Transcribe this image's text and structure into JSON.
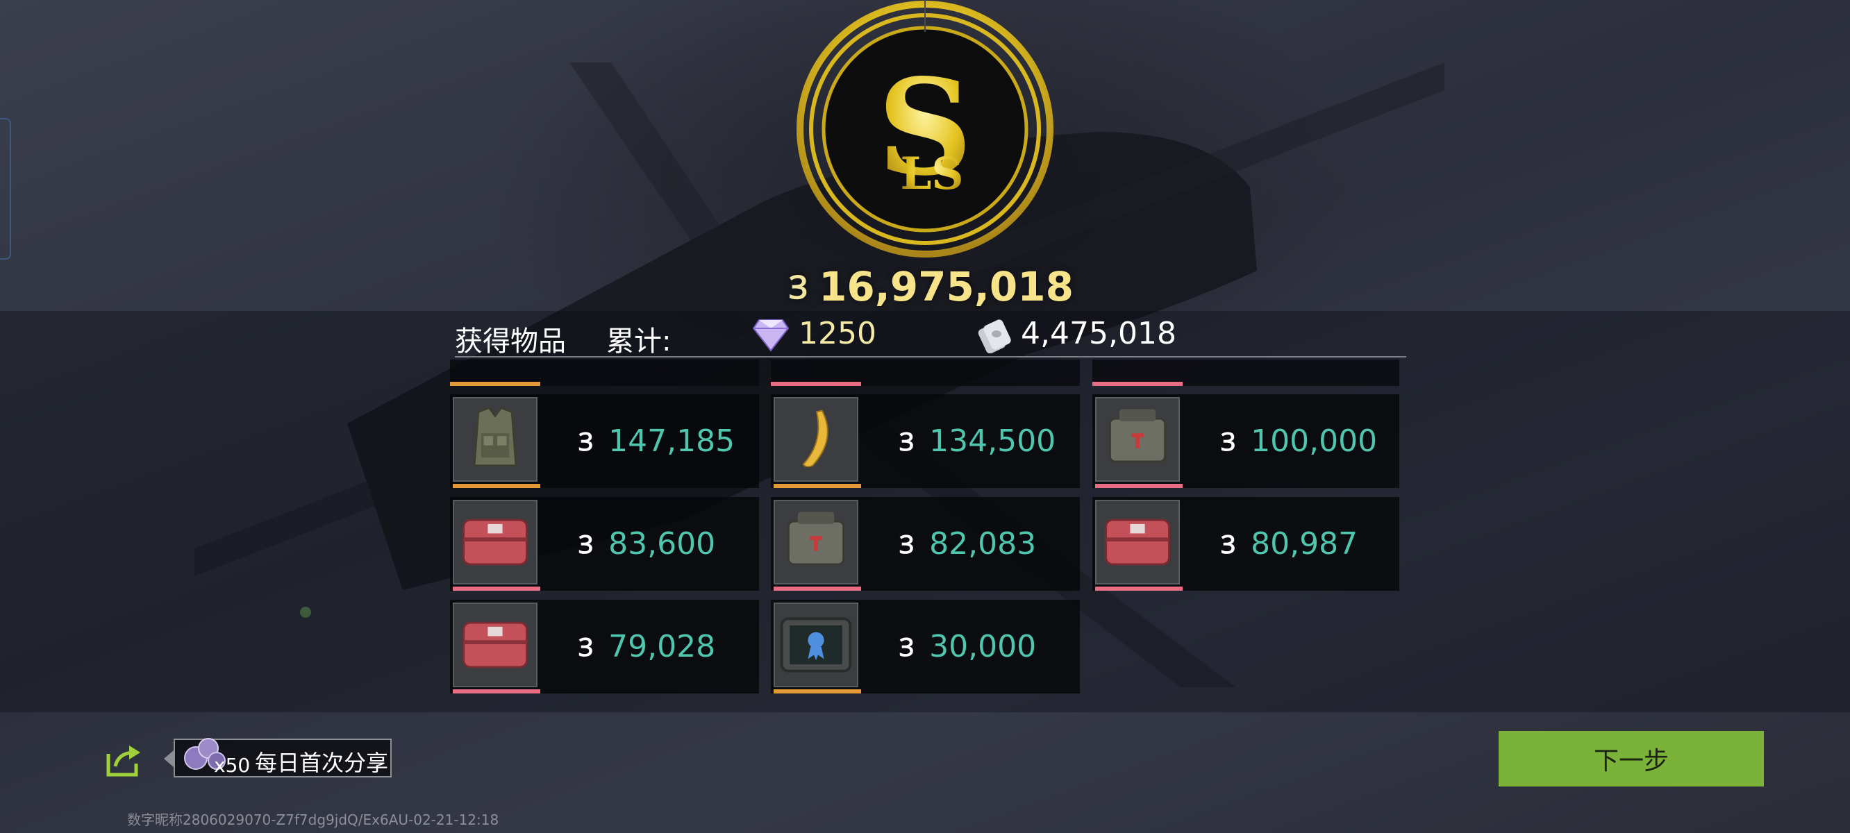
{
  "summary": {
    "coin_symbol": "Ɜ",
    "total_value": "16,975,018",
    "emblem_letter": "S",
    "emblem_sub_letters": "LS"
  },
  "header": {
    "title": "获得物品",
    "accumulated_label": "累计:",
    "gems": "1250",
    "cash": "4,475,018"
  },
  "partial_top_row": [
    {
      "rarity_color": "#e39a36"
    },
    {
      "rarity_color": "#e96e84"
    },
    {
      "rarity_color": "#e96e84"
    }
  ],
  "items": [
    {
      "icon": "tactical-vest-icon",
      "value": "147,185",
      "rarity_color": "#e39a36"
    },
    {
      "icon": "banana-icon",
      "value": "134,500",
      "rarity_color": "#e39a36"
    },
    {
      "icon": "field-bag-icon",
      "value": "100,000",
      "rarity_color": "#e96e84"
    },
    {
      "icon": "red-case-icon",
      "value": "83,600",
      "rarity_color": "#e96e84"
    },
    {
      "icon": "field-bag-icon",
      "value": "82,083",
      "rarity_color": "#e96e84"
    },
    {
      "icon": "red-case-icon",
      "value": "80,987",
      "rarity_color": "#e96e84"
    },
    {
      "icon": "red-case-icon",
      "value": "79,028",
      "rarity_color": "#e96e84"
    },
    {
      "icon": "award-tablet-icon",
      "value": "30,000",
      "rarity_color": "#e39a36"
    }
  ],
  "share": {
    "reward_qty": "x50",
    "label": "每日首次分享"
  },
  "next_button": {
    "label": "下一步"
  },
  "footer": {
    "player_id": "数字昵称2806029070-Z7f7dg9jdQ/Ex6AU-02-21-12:18"
  },
  "colors": {
    "value_teal": "#4fc6ad",
    "gold": "#f7e38a",
    "button_green": "#7bb23a"
  }
}
